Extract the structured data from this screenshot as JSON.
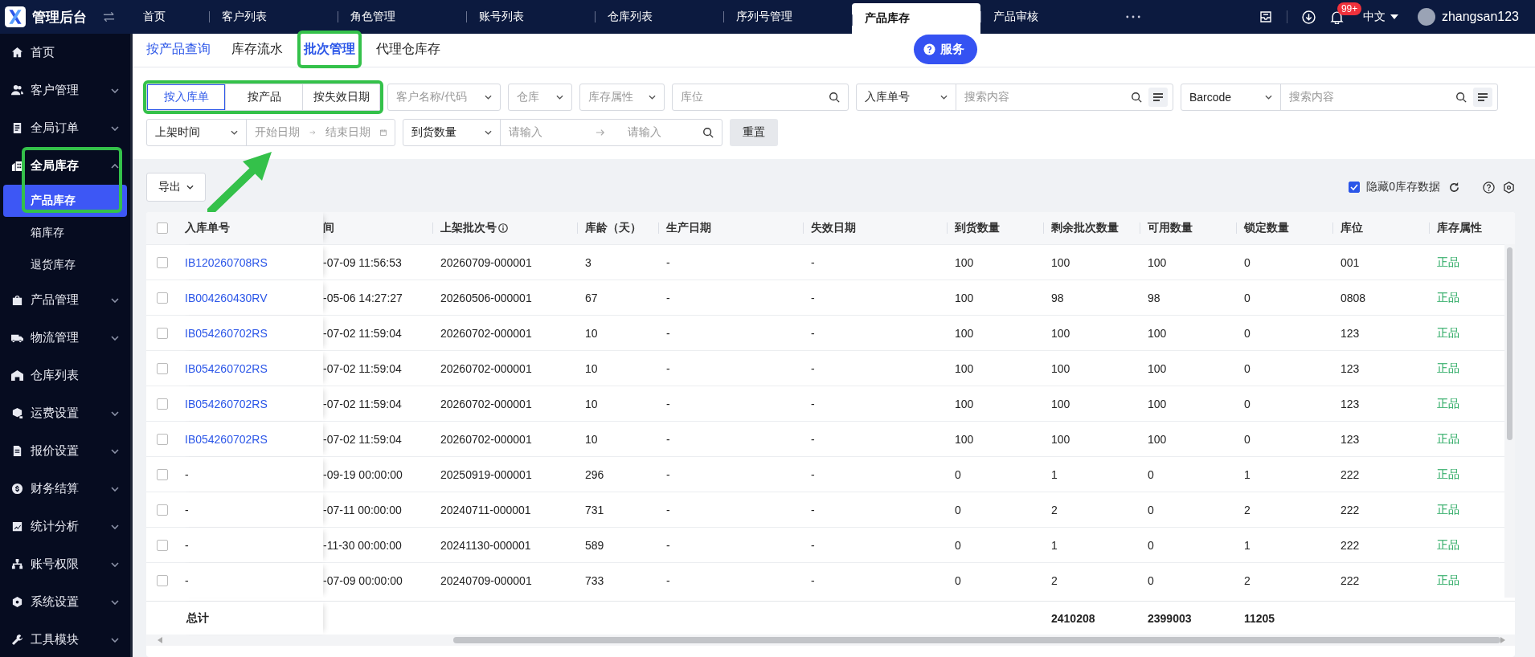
{
  "app": {
    "title": "管理后台"
  },
  "top_tabs": [
    {
      "label": "首页",
      "selected": false
    },
    {
      "label": "客户列表",
      "selected": false
    },
    {
      "label": "角色管理",
      "selected": false
    },
    {
      "label": "账号列表",
      "selected": false
    },
    {
      "label": "仓库列表",
      "selected": false
    },
    {
      "label": "序列号管理",
      "selected": false
    },
    {
      "label": "产品库存",
      "selected": true
    },
    {
      "label": "产品审核",
      "selected": false
    }
  ],
  "header": {
    "notification_badge": "99+",
    "language": "中文",
    "username": "zhangsan123"
  },
  "sidebar": {
    "items": [
      {
        "label": "首页",
        "kind": "link",
        "selected": false
      },
      {
        "label": "客户管理",
        "kind": "group",
        "expanded": false,
        "selected": false
      },
      {
        "label": "全局订单",
        "kind": "group",
        "expanded": false,
        "selected": false
      },
      {
        "label": "全局库存",
        "kind": "group",
        "expanded": true,
        "selected": false,
        "annotated": true,
        "children": [
          {
            "label": "产品库存",
            "selected": true
          },
          {
            "label": "箱库存",
            "selected": false
          },
          {
            "label": "退货库存",
            "selected": false
          }
        ]
      },
      {
        "label": "产品管理",
        "kind": "group",
        "expanded": false,
        "selected": false
      },
      {
        "label": "物流管理",
        "kind": "group",
        "expanded": false,
        "selected": false
      },
      {
        "label": "仓库列表",
        "kind": "link",
        "selected": false
      },
      {
        "label": "运费设置",
        "kind": "group",
        "expanded": false,
        "selected": false
      },
      {
        "label": "报价设置",
        "kind": "group",
        "expanded": false,
        "selected": false
      },
      {
        "label": "财务结算",
        "kind": "group",
        "expanded": false,
        "selected": false
      },
      {
        "label": "统计分析",
        "kind": "group",
        "expanded": false,
        "selected": false
      },
      {
        "label": "账号权限",
        "kind": "group",
        "expanded": false,
        "selected": false
      },
      {
        "label": "系统设置",
        "kind": "group",
        "expanded": false,
        "selected": false
      },
      {
        "label": "工具模块",
        "kind": "group",
        "expanded": false,
        "selected": false
      }
    ]
  },
  "sub_tabs": [
    {
      "label": "按产品查询",
      "selected": false,
      "hovered": true,
      "annotated": false
    },
    {
      "label": "库存流水",
      "selected": false,
      "hovered": false,
      "annotated": false
    },
    {
      "label": "批次管理",
      "selected": true,
      "hovered": false,
      "annotated": true
    },
    {
      "label": "代理仓库存",
      "selected": false,
      "hovered": false,
      "annotated": false
    }
  ],
  "service_button": {
    "label": "服务"
  },
  "filters": {
    "mode_group": {
      "annotated": true,
      "options": [
        {
          "label": "按入库单",
          "selected": true
        },
        {
          "label": "按产品",
          "selected": false
        },
        {
          "label": "按失效日期",
          "selected": false
        }
      ]
    },
    "row1": [
      {
        "kind": "select",
        "placeholder": "客户名称/代码"
      },
      {
        "kind": "select",
        "placeholder": "仓库"
      },
      {
        "kind": "select",
        "placeholder": "库存属性"
      },
      {
        "kind": "search",
        "placeholder": "库位"
      },
      {
        "kind": "combo",
        "value": "入库单号",
        "placeholder": "搜索内容"
      },
      {
        "kind": "combo",
        "value": "Barcode",
        "placeholder": "搜索内容"
      }
    ],
    "row2": [
      {
        "kind": "date_range",
        "value": "上架时间",
        "start_placeholder": "开始日期",
        "end_placeholder": "结束日期"
      },
      {
        "kind": "number_range",
        "value": "到货数量",
        "start_placeholder": "请输入",
        "end_placeholder": "请输入"
      }
    ],
    "reset_button": "重置"
  },
  "toolbar": {
    "export_button": "导出",
    "hide_zero": {
      "label": "隐藏0库存数据",
      "checked": true
    }
  },
  "table": {
    "select_all": {
      "checked": false
    },
    "columns": [
      "入库单号",
      "间",
      "上架批次号",
      "库龄（天）",
      "生产日期",
      "失效日期",
      "到货数量",
      "剩余批次数量",
      "可用数量",
      "锁定数量",
      "库位",
      "库存属性"
    ],
    "rows": [
      {
        "kind": "link",
        "checked": false,
        "cells": [
          "IB120260708RS",
          "-07-09 11:56:53",
          "20260709-000001",
          "3",
          "-",
          "-",
          "100",
          "100",
          "100",
          "0",
          "001",
          "正品"
        ]
      },
      {
        "kind": "link",
        "checked": false,
        "cells": [
          "IB004260430RV",
          "-05-06 14:27:27",
          "20260506-000001",
          "67",
          "-",
          "-",
          "100",
          "98",
          "98",
          "0",
          "0808",
          "正品"
        ]
      },
      {
        "kind": "link",
        "checked": false,
        "cells": [
          "IB054260702RS",
          "-07-02 11:59:04",
          "20260702-000001",
          "10",
          "-",
          "-",
          "100",
          "100",
          "100",
          "0",
          "123",
          "正品"
        ]
      },
      {
        "kind": "link",
        "checked": false,
        "cells": [
          "IB054260702RS",
          "-07-02 11:59:04",
          "20260702-000001",
          "10",
          "-",
          "-",
          "100",
          "100",
          "100",
          "0",
          "123",
          "正品"
        ]
      },
      {
        "kind": "link",
        "checked": false,
        "cells": [
          "IB054260702RS",
          "-07-02 11:59:04",
          "20260702-000001",
          "10",
          "-",
          "-",
          "100",
          "100",
          "100",
          "0",
          "123",
          "正品"
        ]
      },
      {
        "kind": "link",
        "checked": false,
        "cells": [
          "IB054260702RS",
          "-07-02 11:59:04",
          "20260702-000001",
          "10",
          "-",
          "-",
          "100",
          "100",
          "100",
          "0",
          "123",
          "正品"
        ]
      },
      {
        "kind": "plain",
        "checked": false,
        "cells": [
          "-",
          "-09-19 00:00:00",
          "20250919-000001",
          "296",
          "-",
          "-",
          "0",
          "1",
          "0",
          "1",
          "222",
          "正品"
        ]
      },
      {
        "kind": "plain",
        "checked": false,
        "cells": [
          "-",
          "-07-11 00:00:00",
          "20240711-000001",
          "731",
          "-",
          "-",
          "0",
          "2",
          "0",
          "2",
          "222",
          "正品"
        ]
      },
      {
        "kind": "plain",
        "checked": false,
        "cells": [
          "-",
          "-11-30 00:00:00",
          "20241130-000001",
          "589",
          "-",
          "-",
          "0",
          "1",
          "0",
          "1",
          "222",
          "正品"
        ]
      },
      {
        "kind": "plain",
        "checked": false,
        "cells": [
          "-",
          "-07-09 00:00:00",
          "20240709-000001",
          "733",
          "-",
          "-",
          "0",
          "2",
          "0",
          "2",
          "222",
          "正品"
        ]
      }
    ],
    "totals": {
      "label": "总计",
      "remaining": "2410208",
      "available": "2399003",
      "locked": "11205"
    }
  }
}
